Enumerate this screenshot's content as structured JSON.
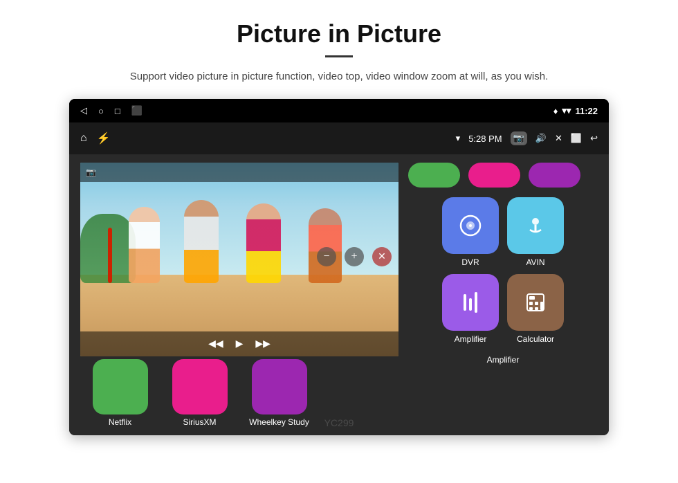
{
  "page": {
    "title": "Picture in Picture",
    "subtitle": "Support video picture in picture function, video top, video window zoom at will, as you wish.",
    "divider_color": "#333"
  },
  "status_bar": {
    "back_icon": "◁",
    "home_icon": "○",
    "recents_icon": "□",
    "screenshot_icon": "⬛",
    "location_icon": "▼",
    "wifi_icon": "▼",
    "time": "11:22"
  },
  "nav_bar": {
    "home_icon": "⌂",
    "usb_icon": "⚡",
    "wifi_icon": "▼",
    "time": "5:28 PM",
    "camera_icon": "📷",
    "volume_icon": "🔊",
    "close_icon": "✕",
    "window_icon": "⬜",
    "back_icon": "↩"
  },
  "pip": {
    "controls_minus": "−",
    "controls_plus": "+",
    "controls_close": "✕",
    "play_prev": "◀◀",
    "play_toggle": "▶",
    "play_next": "▶▶",
    "camera_overlay": "📷"
  },
  "apps": {
    "row1": [
      {
        "id": "dvr",
        "label": "DVR",
        "bg": "#5b7be8",
        "icon": "◎"
      },
      {
        "id": "avin",
        "label": "AVIN",
        "bg": "#5bc8e8",
        "icon": "🎛"
      }
    ],
    "row2": [
      {
        "id": "amplifier",
        "label": "Amplifier",
        "bg": "#9b5be8",
        "icon": "🎚"
      },
      {
        "id": "calculator",
        "label": "Calculator",
        "bg": "#8B6347",
        "icon": "⊞"
      }
    ]
  },
  "bottom_apps": [
    {
      "id": "netflix",
      "label": "Netflix",
      "bg": "#4caf50"
    },
    {
      "id": "siriusxm",
      "label": "SiriusXM",
      "bg": "#e91e8c"
    },
    {
      "id": "wheelkey",
      "label": "Wheelkey Study",
      "bg": "#9c27b0"
    },
    {
      "id": "amplifier2",
      "label": "Amplifier",
      "bg": "#9b5be8"
    }
  ],
  "watermark": "YC299"
}
